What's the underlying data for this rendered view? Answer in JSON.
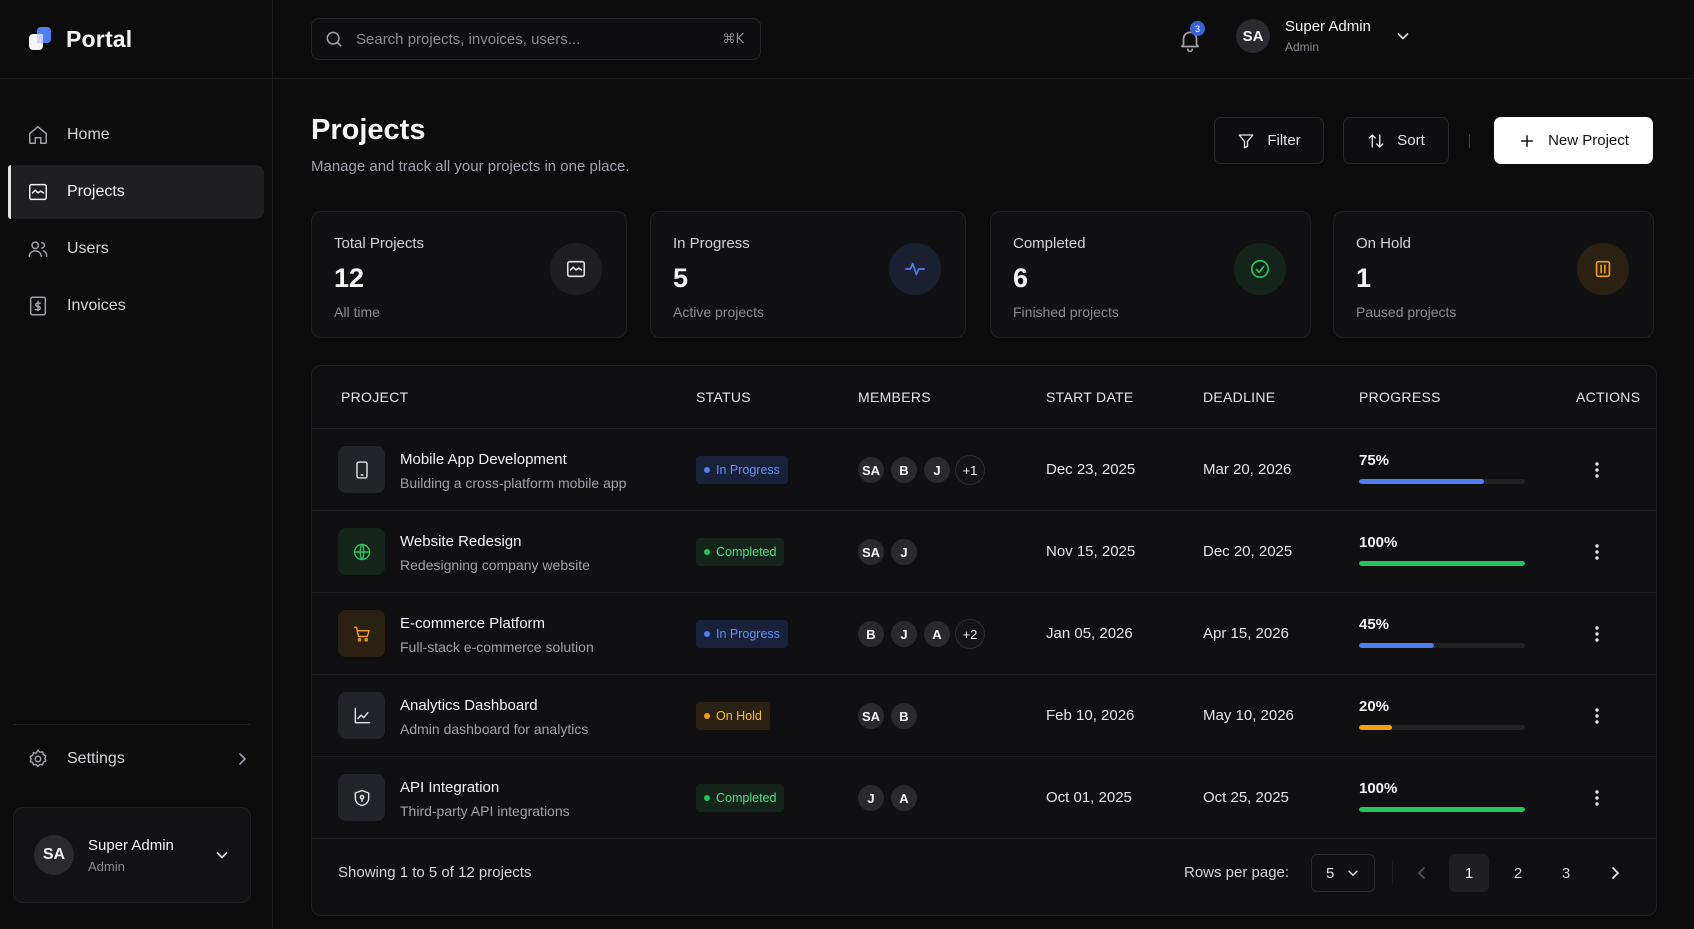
{
  "brand": {
    "name": "Portal"
  },
  "sidebar": {
    "items": [
      {
        "label": "Home",
        "icon": "home-icon",
        "active": false
      },
      {
        "label": "Projects",
        "icon": "folder-icon",
        "active": true
      },
      {
        "label": "Users",
        "icon": "users-icon",
        "active": false
      },
      {
        "label": "Invoices",
        "icon": "invoice-icon",
        "active": false
      }
    ],
    "settings_label": "Settings",
    "user": {
      "initials": "SA",
      "name": "Super Admin",
      "role": "Admin"
    }
  },
  "topbar": {
    "search_placeholder": "Search projects, invoices, users...",
    "search_shortcut": "⌘K",
    "notification_count": "3",
    "user": {
      "initials": "SA",
      "name": "Super Admin",
      "role": "Admin"
    }
  },
  "header": {
    "title": "Projects",
    "subtitle": "Manage and track all your projects in one place.",
    "filter_label": "Filter",
    "sort_label": "Sort",
    "new_label": "New Project"
  },
  "stats": [
    {
      "label": "Total Projects",
      "value": "12",
      "sub": "All time",
      "icon": "folder-icon",
      "color": "#e4e4e7",
      "bg": "#1f1f22"
    },
    {
      "label": "In Progress",
      "value": "5",
      "sub": "Active projects",
      "icon": "activity-icon",
      "color": "#4f7df0",
      "bg": "#1a2030"
    },
    {
      "label": "Completed",
      "value": "6",
      "sub": "Finished projects",
      "icon": "check-circle-icon",
      "color": "#22c55e",
      "bg": "#15241b"
    },
    {
      "label": "On Hold",
      "value": "1",
      "sub": "Paused projects",
      "icon": "pause-icon",
      "color": "#f59e0b",
      "bg": "#2b2113"
    }
  ],
  "table": {
    "columns": [
      "PROJECT",
      "STATUS",
      "MEMBERS",
      "START DATE",
      "DEADLINE",
      "PROGRESS",
      "ACTIONS"
    ],
    "rows": [
      {
        "name": "Mobile App Development",
        "desc": "Building a cross-platform mobile app",
        "icon": "smartphone-icon",
        "status": "In Progress",
        "members": [
          "SA",
          "B",
          "J"
        ],
        "more": "+1",
        "start": "Dec 23, 2025",
        "deadline": "Mar 20, 2026",
        "progress_label": "75%",
        "progress": 75
      },
      {
        "name": "Website Redesign",
        "desc": "Redesigning company website",
        "icon": "globe-icon",
        "status": "Completed",
        "members": [
          "SA",
          "J"
        ],
        "more": "",
        "start": "Nov 15, 2025",
        "deadline": "Dec 20, 2025",
        "progress_label": "100%",
        "progress": 100
      },
      {
        "name": "E-commerce Platform",
        "desc": "Full-stack e-commerce solution",
        "icon": "cart-icon",
        "status": "In Progress",
        "members": [
          "B",
          "J",
          "A"
        ],
        "more": "+2",
        "start": "Jan 05, 2026",
        "deadline": "Apr 15, 2026",
        "progress_label": "45%",
        "progress": 45
      },
      {
        "name": "Analytics Dashboard",
        "desc": "Admin dashboard for analytics",
        "icon": "chart-icon",
        "status": "On Hold",
        "members": [
          "SA",
          "B"
        ],
        "more": "",
        "start": "Feb 10, 2026",
        "deadline": "May 10, 2026",
        "progress_label": "20%",
        "progress": 20
      },
      {
        "name": "API Integration",
        "desc": "Third-party API integrations",
        "icon": "shield-icon",
        "status": "Completed",
        "members": [
          "J",
          "A"
        ],
        "more": "",
        "start": "Oct 01, 2025",
        "deadline": "Oct 25, 2025",
        "progress_label": "100%",
        "progress": 100
      }
    ]
  },
  "footer": {
    "showing": "Showing 1 to 5 of 12 projects",
    "rows_per_page_label": "Rows per page:",
    "rows_per_page": "5",
    "pages": [
      "1",
      "2",
      "3"
    ],
    "current_page": "1"
  },
  "colors": {
    "in_progress": "#4f7df0",
    "completed": "#22c55e",
    "on_hold": "#f59e0b"
  }
}
